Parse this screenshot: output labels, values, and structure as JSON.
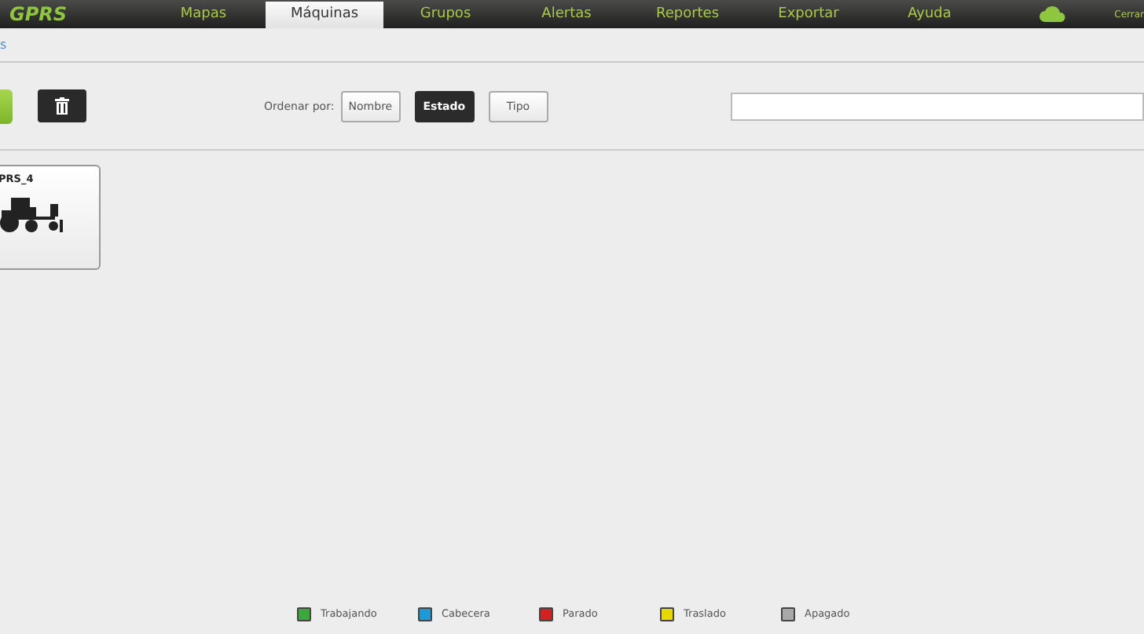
{
  "logo": "GPRS",
  "nav": [
    {
      "label": "Mapas",
      "selected": false
    },
    {
      "label": "Máquinas",
      "selected": true
    },
    {
      "label": "Grupos",
      "selected": false
    },
    {
      "label": "Alertas",
      "selected": false
    },
    {
      "label": "Reportes",
      "selected": false
    },
    {
      "label": "Exportar",
      "selected": false
    },
    {
      "label": "Ayuda",
      "selected": false
    }
  ],
  "logout": "Cerrar",
  "breadcrumb": "s",
  "sort": {
    "label": "Ordenar por:",
    "options": [
      {
        "label": "Nombre",
        "selected": false
      },
      {
        "label": "Estado",
        "selected": true
      },
      {
        "label": "Tipo",
        "selected": false
      }
    ]
  },
  "machines": [
    {
      "name": "PRS_4",
      "kind": "tractor"
    }
  ],
  "legend": [
    {
      "label": "Trabajando",
      "color": "#3aa83a"
    },
    {
      "label": "Cabecera",
      "color": "#1e9ad6"
    },
    {
      "label": "Parado",
      "color": "#d42020"
    },
    {
      "label": "Traslado",
      "color": "#e8d800"
    },
    {
      "label": "Apagado",
      "color": "#a8a8a8"
    }
  ]
}
